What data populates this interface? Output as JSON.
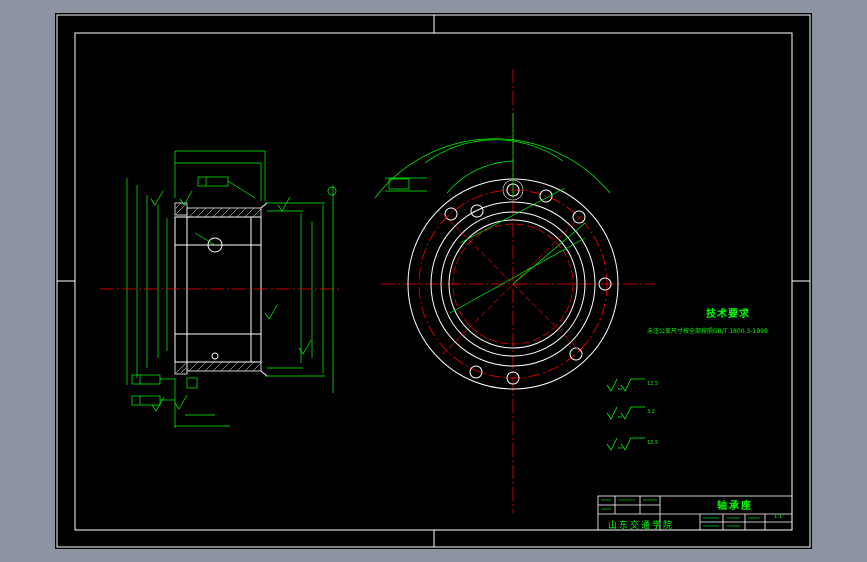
{
  "drawing": {
    "tech_requirements_title": "技术要求",
    "tech_requirements_note": "未注公差尺寸按全部按照GB/T 1800.3-1998",
    "roughness_symbols": [
      {
        "value": "12.5"
      },
      {
        "value": "3.2"
      },
      {
        "value": "12.5"
      }
    ]
  },
  "title_block": {
    "part_name": "轴承座",
    "school": "山东交通学院",
    "scale": "1:1"
  },
  "colors": {
    "background": "#000000",
    "frame": "#ffffff",
    "dimension": "#00ff00",
    "centerline": "#ff0000",
    "app_background": "#8c93a1"
  }
}
